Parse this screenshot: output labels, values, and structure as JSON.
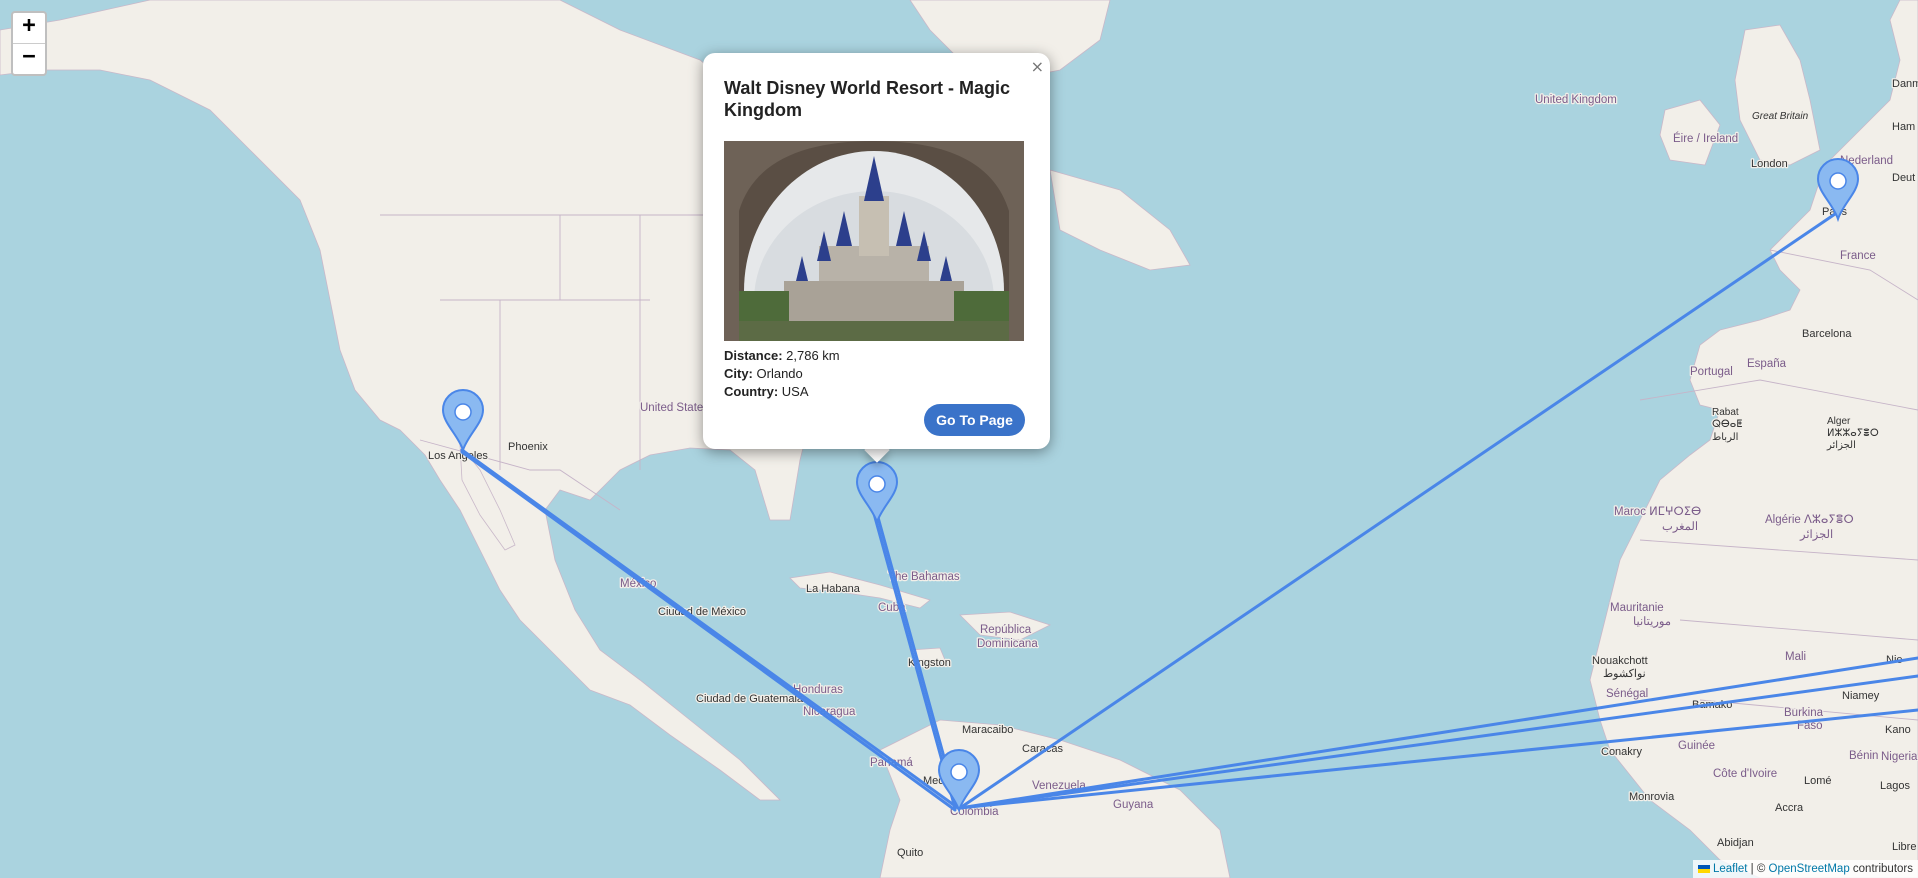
{
  "zoom": {
    "in_label": "+",
    "out_label": "−"
  },
  "places": {
    "united_kingdom": "United Kingdom",
    "great_britain": "Great Britain",
    "eire": "Éire / Ireland",
    "london": "London",
    "nederland": "Nederland",
    "paris": "Paris",
    "france": "France",
    "barcelona": "Barcelona",
    "portugal": "Portugal",
    "espana": "España",
    "rabat": "Rabat",
    "rabat_tifinagh": "ⵕⴱⴰⵟ",
    "rabat_ar": "الرباط",
    "alger": "Alger",
    "alger_tifinagh": "ⵍⵣⵣⴰⵢⴻⵔ",
    "alger_ar": "الجزائر",
    "maroc": "Maroc ⵍⵎⵖⵔⵉⴱ",
    "maroc_ar": "المغرب",
    "algerie": "Algérie ⴷⵣⴰⵢⴻⵔ",
    "algerie_ar": "الجزائر",
    "mauritanie": "Mauritanie",
    "mauritanie_ar": "موريتانيا",
    "nouakchott": "Nouakchott",
    "nouakchott_ar": "نواكشوط",
    "senegal": "Sénégal",
    "bamako": "Bamako",
    "mali": "Mali",
    "niamey": "Niamey",
    "burkina": "Burkina",
    "faso": "Faso",
    "guinee": "Guinée",
    "conakry": "Conakry",
    "benin": "Bénin",
    "nigeria": "Nigeria",
    "kano": "Kano",
    "cote_divoire": "Côte d'Ivoire",
    "monrovia": "Monrovia",
    "lome": "Lomé",
    "lagos": "Lagos",
    "abidjan": "Abidjan",
    "accra": "Accra",
    "united_states": "United States",
    "los_angeles": "Los Angeles",
    "phoenix": "Phoenix",
    "mexico": "México",
    "ciudad_de_mexico": "Ciudad de México",
    "la_habana": "La Habana",
    "cuba": "Cuba",
    "bahamas": "The Bahamas",
    "republica": "República",
    "dominicana": "Dominicana",
    "kingston": "Kingston",
    "ciudad_de_guatemala": "Ciudad de Guatemala",
    "honduras": "Honduras",
    "nicaragua": "Nicaragua",
    "panama": "Panamá",
    "maracaibo": "Maracaibo",
    "caracas": "Caracas",
    "venezuela": "Venezuela",
    "guyana": "Guyana",
    "colombia": "Colombia",
    "medellin": "Mede",
    "quito": "Quito",
    "libreville": "Libre",
    "nie": "Nie",
    "deut": "Deut",
    "danm": "Danm",
    "ham": "Ham"
  },
  "colors": {
    "water": "#aad3df",
    "land": "#f2efe9",
    "route": "#4a86e8",
    "marker": "#8ab9f1"
  },
  "markers": [
    "Los Angeles",
    "Orlando",
    "Colombia",
    "Paris"
  ],
  "popup": {
    "close": "×",
    "title": "Walt Disney World Resort - Magic Kingdom",
    "distance_label": "Distance:",
    "distance": "2,786 km",
    "city_label": "City:",
    "city": "Orlando",
    "country_label": "Country:",
    "country": "USA",
    "button": "Go To Page"
  },
  "attribution": {
    "leaflet": "Leaflet",
    "sep": " | © ",
    "osm": "OpenStreetMap",
    "suffix": " contributors"
  }
}
